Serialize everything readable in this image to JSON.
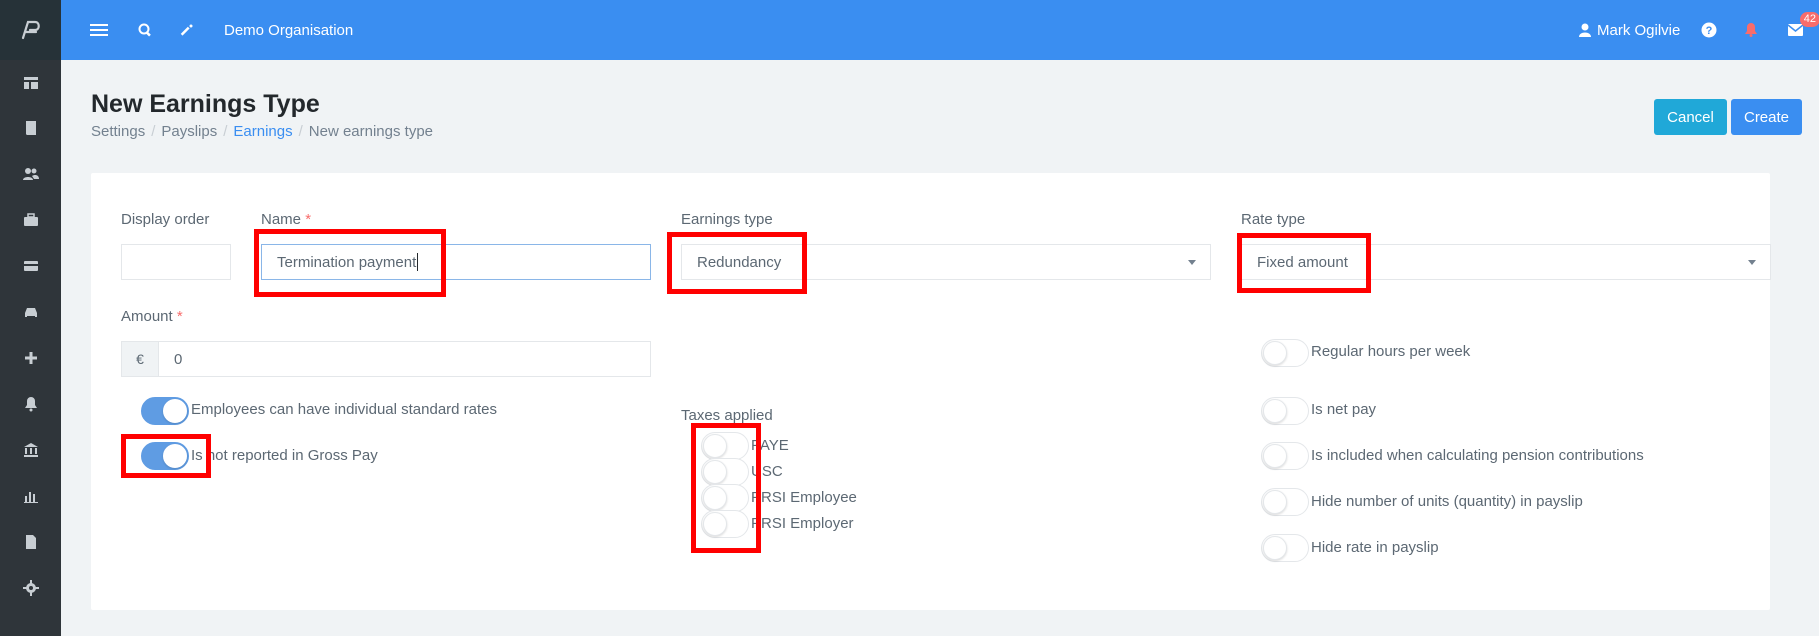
{
  "app": {
    "organisation": "Demo Organisation",
    "user_name": "Mark Ogilvie",
    "notification_count": "42"
  },
  "sidebar": {
    "icons": [
      "dashboard-icon",
      "book-icon",
      "people-icon",
      "briefcase-icon",
      "card-icon",
      "car-icon",
      "plus-icon",
      "bell-icon",
      "bank-icon",
      "chart-icon",
      "file-icon",
      "gear-icon"
    ]
  },
  "header": {
    "title": "New Earnings Type",
    "breadcrumb": [
      "Settings",
      "Payslips",
      "Earnings",
      "New earnings type"
    ],
    "cancel_label": "Cancel",
    "create_label": "Create"
  },
  "form": {
    "display_order": {
      "label": "Display order",
      "value": ""
    },
    "name": {
      "label": "Name",
      "required": "*",
      "value": "Termination payment"
    },
    "earnings_type": {
      "label": "Earnings type",
      "value": "Redundancy"
    },
    "rate_type": {
      "label": "Rate type",
      "value": "Fixed amount"
    },
    "amount": {
      "label": "Amount",
      "required": "*",
      "currency": "€",
      "value": "0"
    },
    "left_toggles": [
      {
        "label": "Employees can have individual standard rates",
        "on": true
      },
      {
        "label": "Is not reported in Gross Pay",
        "on": true
      }
    ],
    "taxes_applied": {
      "label": "Taxes applied",
      "items": [
        {
          "label": "PAYE",
          "on": false
        },
        {
          "label": "USC",
          "on": false
        },
        {
          "label": "PRSI Employee",
          "on": false
        },
        {
          "label": "PRSI Employer",
          "on": false
        }
      ]
    },
    "right_toggles": [
      {
        "label": "Regular hours per week",
        "on": false
      },
      {
        "label": "Is net pay",
        "on": false
      },
      {
        "label": "Is included when calculating pension contributions",
        "on": false
      },
      {
        "label": "Hide number of units (quantity) in payslip",
        "on": false
      },
      {
        "label": "Hide rate in payslip",
        "on": false
      }
    ]
  },
  "colors": {
    "topbar": "#3a8ef1",
    "sidebar": "#2f353a",
    "accent": "#3a8ef1",
    "highlight": "#ff0000"
  }
}
